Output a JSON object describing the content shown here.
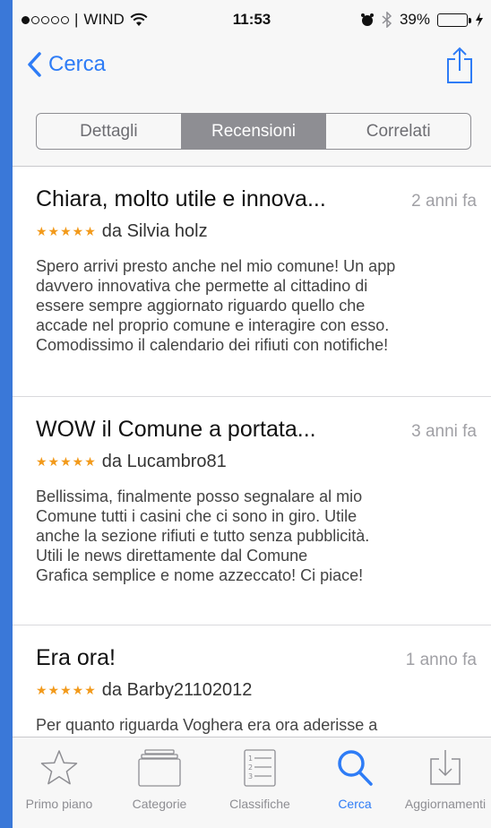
{
  "status_bar": {
    "carrier": "WIND",
    "time": "11:53",
    "battery": "39%",
    "battery_level": 0.39,
    "signal_bars_filled": 1,
    "signal_bars_total": 5
  },
  "nav": {
    "back_label": "Cerca",
    "share_icon": "share-icon"
  },
  "segments": [
    {
      "label": "Dettagli",
      "active": false
    },
    {
      "label": "Recensioni",
      "active": true
    },
    {
      "label": "Correlati",
      "active": false
    }
  ],
  "reviews": [
    {
      "title": "Chiara, molto utile e innova...",
      "date": "2 anni fa",
      "stars": "★★★★★",
      "author": "da Silvia holz",
      "body": "Spero arrivi presto anche nel mio comune! Un app\ndavvero innovativa che permette al cittadino di\nessere sempre aggiornato riguardo quello che\naccade nel proprio comune e interagire con esso.\nComodissimo il calendario dei rifiuti con notifiche!"
    },
    {
      "title": "WOW il Comune a portata...",
      "date": "3 anni fa",
      "stars": "★★★★★",
      "author": "da Lucambro81",
      "body": "Bellissima, finalmente posso segnalare al mio\nComune tutti i casini che ci sono in giro. Utile\nanche la sezione rifiuti e tutto senza pubblicità.\nUtili le news direttamente dal Comune\nGrafica semplice e nome azzeccato! Ci piace!"
    },
    {
      "title": "Era ora!",
      "date": "1 anno fa",
      "stars": "★★★★★",
      "author": "da Barby21102012",
      "body": "Per quanto riguarda Voghera era ora aderisse a\nquesta app. Così uno ha tutto su un clic. L unico"
    }
  ],
  "tabs": [
    {
      "label": "Primo piano",
      "icon": "star-icon",
      "active": false
    },
    {
      "label": "Categorie",
      "icon": "categories-icon",
      "active": false
    },
    {
      "label": "Classifiche",
      "icon": "list-icon",
      "active": false
    },
    {
      "label": "Cerca",
      "icon": "search-icon",
      "active": true
    },
    {
      "label": "Aggiornamenti",
      "icon": "download-icon",
      "active": false
    }
  ],
  "colors": {
    "accent": "#2e7cf6",
    "stars": "#f29a1b",
    "battery": "#2ecc40",
    "frame": "#3a78d8"
  }
}
